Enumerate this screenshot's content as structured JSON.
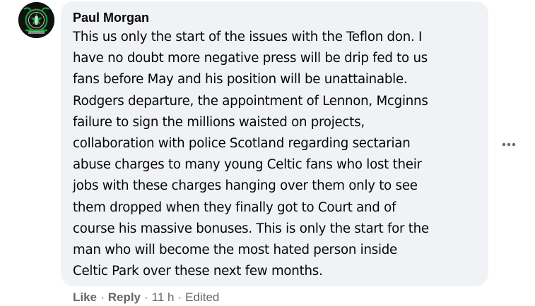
{
  "comment": {
    "author": "Paul Morgan",
    "text_lines": [
      "This us only the start of the issues with the Teflon don. I",
      "have no doubt more negative press will be drip fed to us",
      "fans before May and his position will be unattainable.",
      "Rodgers departure, the appointment of Lennon, Mcginns",
      "failure to sign the millions waisted on projects,",
      "collaboration with police Scotland regarding sectarian",
      "abuse charges to many young Celtic fans who lost their",
      "jobs with these charges hanging over them only to see",
      "them dropped when they finally got to Court and of",
      "course his massive bonuses. This is only the start for the",
      "man who will become the most hated person inside",
      "Celtic Park over these next few months."
    ],
    "actions": {
      "like": "Like",
      "reply": "Reply",
      "time": "11 h",
      "edited": "Edited",
      "separator": "·"
    },
    "more_icon": "more-horizontal-icon"
  },
  "colors": {
    "bubble_bg": "#f0f2f5",
    "text": "#050505",
    "secondary": "#65676b",
    "avatar_bg": "#0e130e",
    "avatar_green": "#1f8a3a"
  }
}
